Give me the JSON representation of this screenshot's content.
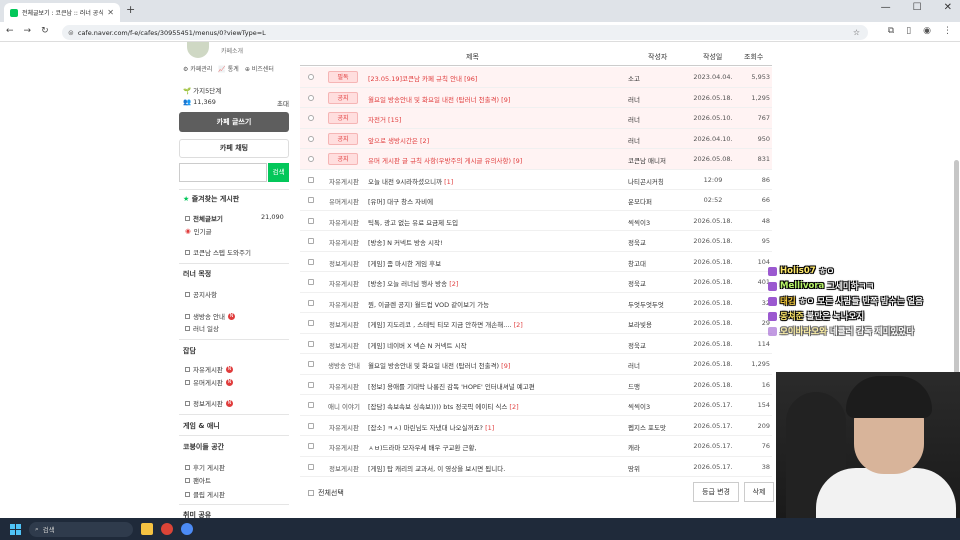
{
  "browser": {
    "tab_title": "전체글보기 : 코큰남 :: 러너 공식",
    "new_tab": "+",
    "url": "cafe.naver.com/f-e/cafes/30955451/menus/0?viewType=L"
  },
  "sidebar": {
    "cafe_intro": "카페소개",
    "links": [
      "카페관리",
      "통계",
      "비즈센터"
    ],
    "member_level": "가지5단계",
    "member_count": "11,369",
    "invite": "초대",
    "write_button": "카페 글쓰기",
    "chat_button": "카페 채팅",
    "search_button": "검색",
    "favorites_title": "즐겨찾는 게시판",
    "all_posts": "전체글보기",
    "all_posts_count": "21,090",
    "popular": "인기글",
    "store": "코큰남 스텝 도와주기",
    "section_runner": "러너 목정",
    "notice": "공지사항",
    "broadcast": "생방송 안내",
    "runner_daily": "러너 일상",
    "section_chat": "잡담",
    "free_board": "자유게시판",
    "humor_board": "유머게시판",
    "info_board": "정보게시판",
    "section_game": "게임 & 애니",
    "section_corner": "코붕이들 공간",
    "review_board": "후기 게시판",
    "fanart": "팬아트",
    "clip_board": "클립 게시판",
    "section_bottom": "취미 공유"
  },
  "table": {
    "headers": {
      "title": "제목",
      "author": "작성자",
      "date": "작성일",
      "views": "조회수"
    },
    "rows": [
      {
        "type": "notice",
        "badge": "필독",
        "title": "[23.05.19]코큰남 카페 규칙 안내",
        "comments": "[96]",
        "author": "소고",
        "date": "2023.04.04.",
        "views": "5,953"
      },
      {
        "type": "notice",
        "badge": "공지",
        "title": "월요일 방송안내 및 화요일 내전 (탑러너 천출격)",
        "comments": "[9]",
        "author": "러너",
        "date": "2026.05.18.",
        "views": "1,295"
      },
      {
        "type": "notice",
        "badge": "공지",
        "title": "자전거",
        "comments": "[15]",
        "author": "러너",
        "date": "2026.05.10.",
        "views": "767"
      },
      {
        "type": "notice",
        "badge": "공지",
        "title": "앞으로 생방시간은",
        "comments": "[2]",
        "author": "러너",
        "date": "2026.04.10.",
        "views": "950"
      },
      {
        "type": "notice",
        "badge": "공지",
        "title": "유머 게시판 글 규칙 사항(우방주의 게시글 유의사항)",
        "comments": "[9]",
        "author": "코큰남 매니저",
        "date": "2026.05.08.",
        "views": "831"
      },
      {
        "type": "post",
        "cat": "자유게시판",
        "title": "오늘 내전 9시라하셨으니까",
        "comments": "[1]",
        "author": "나티곤시커칭",
        "date": "12:09",
        "views": "86"
      },
      {
        "type": "post",
        "cat": "유머게시판",
        "title": "[유머] 대구 창스 자비에",
        "comments": "",
        "author": "운모다퍼",
        "date": "02:52",
        "views": "66"
      },
      {
        "type": "post",
        "cat": "자유게시판",
        "title": "틱톡, 광고 없는 유료 요금제 도입",
        "comments": "",
        "author": "씩씩이3",
        "date": "2026.05.18.",
        "views": "48"
      },
      {
        "type": "post",
        "cat": "자유게시판",
        "title": "[방송] N 커넥트 방송 시작!",
        "comments": "",
        "author": "정욱교",
        "date": "2026.05.18.",
        "views": "95"
      },
      {
        "type": "post",
        "cat": "정보게시판",
        "title": "[게임] 좀 마시한 게임 후보",
        "comments": "",
        "author": "창고대",
        "date": "2026.05.18.",
        "views": "104"
      },
      {
        "type": "post",
        "cat": "자유게시판",
        "title": "[방송] 오늘 러너님 행사 방송",
        "comments": "[2]",
        "author": "정욱교",
        "date": "2026.05.18.",
        "views": "401"
      },
      {
        "type": "post",
        "cat": "자유게시판",
        "title": "뭔, 이글렌 공지) 월드컵 VOD 같이보기 가능",
        "comments": "",
        "author": "두엇두엇두엇",
        "date": "2026.05.18.",
        "views": "32"
      },
      {
        "type": "post",
        "cat": "정보게시판",
        "title": "[게임] 지도리코 , 스테틱 티모 지금 안하면 개손해....",
        "comments": "[2]",
        "author": "보라빛용",
        "date": "2026.05.18.",
        "views": "29"
      },
      {
        "type": "post",
        "cat": "정보게시판",
        "title": "[게임] 네이버 X 넥슨 N 커넥트 시작",
        "comments": "",
        "author": "정욱교",
        "date": "2026.05.18.",
        "views": "114"
      },
      {
        "type": "post",
        "cat": "생방송 안내",
        "title": "월요일 방송안내 및 화요일 내전 (탑러너 천출격)",
        "comments": "[9]",
        "author": "러너",
        "date": "2026.05.18.",
        "views": "1,295"
      },
      {
        "type": "post",
        "cat": "자유게시판",
        "title": "[정보] 용애를 기대탁 나롱진 감독 'HOPE' 인터내셔널 예고편",
        "comments": "",
        "author": "드맹",
        "date": "2026.05.18.",
        "views": "16"
      },
      {
        "type": "post",
        "cat": "애니 이야기",
        "title": "[잡담] 속보속보 싱속보)))) bts 정국픽 에이티 식스",
        "comments": "[2]",
        "author": "씩씩이3",
        "date": "2026.05.17.",
        "views": "154"
      },
      {
        "type": "post",
        "cat": "자유게시판",
        "title": "[잡소] ㅋㅅ) 마린님도 자냈대 나오실꺼죠?",
        "comments": "[1]",
        "author": "펩지스 포도맛",
        "date": "2026.05.17.",
        "views": "209"
      },
      {
        "type": "post",
        "cat": "자유게시판",
        "title": "ㅅㅂ)드라마 모자우세 배우 구교환 근황,",
        "comments": "",
        "author": "캐라",
        "date": "2026.05.17.",
        "views": "76"
      },
      {
        "type": "post",
        "cat": "정보게시판",
        "title": "[게임] 탑 캐리의 교과서, 이 영상을 보시면 됩니다.",
        "comments": "",
        "author": "땅위",
        "date": "2026.05.17.",
        "views": "38"
      }
    ]
  },
  "footer": {
    "select_all": "전체선택",
    "grade_change": "등급 변경",
    "delete": "삭제"
  },
  "chat": [
    {
      "nick": "Holis07",
      "msg": "ㅎㅇ",
      "nick_color": "#ffe86a"
    },
    {
      "nick": "Mellivora",
      "msg": "그세미하ㅋㅋ",
      "nick_color": "#b8f56a"
    },
    {
      "nick": "태김",
      "msg": "ㅎㅇ 모든 사람들 반쪽 밤수는 얼음",
      "nick_color": "#ffd23f"
    },
    {
      "nick": "몽쳐준",
      "msg": "불만은 녹나오지",
      "nick_color": "#ffe86a"
    },
    {
      "nick": "오이바라오와",
      "msg": "네클러 감독 제미있었다",
      "nick_color": "#ffe86a"
    }
  ],
  "taskbar": {
    "search_placeholder": "검색"
  }
}
